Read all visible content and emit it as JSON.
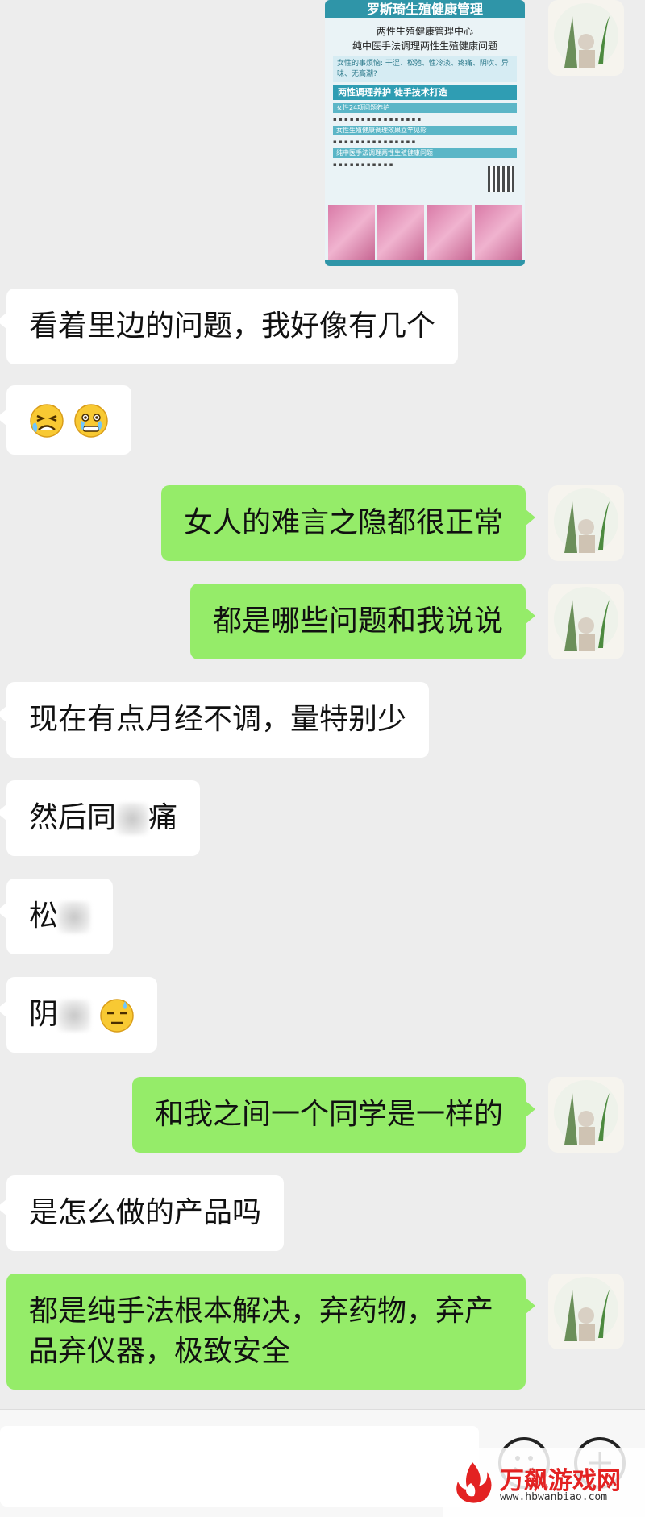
{
  "poster": {
    "title": "罗斯琦生殖健康管理",
    "line1": "两性生殖健康管理中心",
    "line2": "纯中医手法调理两性生殖健康问题",
    "box_text": "女性的事烦恼: 干涩、松弛、性冷淡、疼痛、阴吹、异味、无高潮?",
    "band": "两性调理养护 徒手技术打造",
    "sub1": "女性24项问题养护",
    "sub2": "女性生殖健康调理效果立竿见影",
    "sub3": "纯中医手法调理两性生殖健康问题"
  },
  "messages": [
    {
      "side": "in",
      "text": "看着里边的问题，我好像有几个"
    },
    {
      "side": "in",
      "emoji": [
        "crying-emoji",
        "teary-emoji"
      ]
    },
    {
      "side": "out",
      "text": "女人的难言之隐都很正常"
    },
    {
      "side": "out",
      "text": "都是哪些问题和我说说"
    },
    {
      "side": "in",
      "text": "现在有点月经不调，量特别少"
    },
    {
      "side": "in",
      "text_a": "然后同",
      "text_b": "痛"
    },
    {
      "side": "in",
      "text_a": "松"
    },
    {
      "side": "in",
      "text_a": "阴"
    },
    {
      "side": "out",
      "text": "和我之间一个同学是一样的"
    },
    {
      "side": "in",
      "text": "是怎么做的产品吗"
    },
    {
      "side": "out",
      "text": "都是纯手法根本解决，弃药物，弃产品弃仪器，极致安全"
    }
  ],
  "watermark": {
    "title": "万飙游戏网",
    "url": "www.hbwanbiao.com"
  }
}
